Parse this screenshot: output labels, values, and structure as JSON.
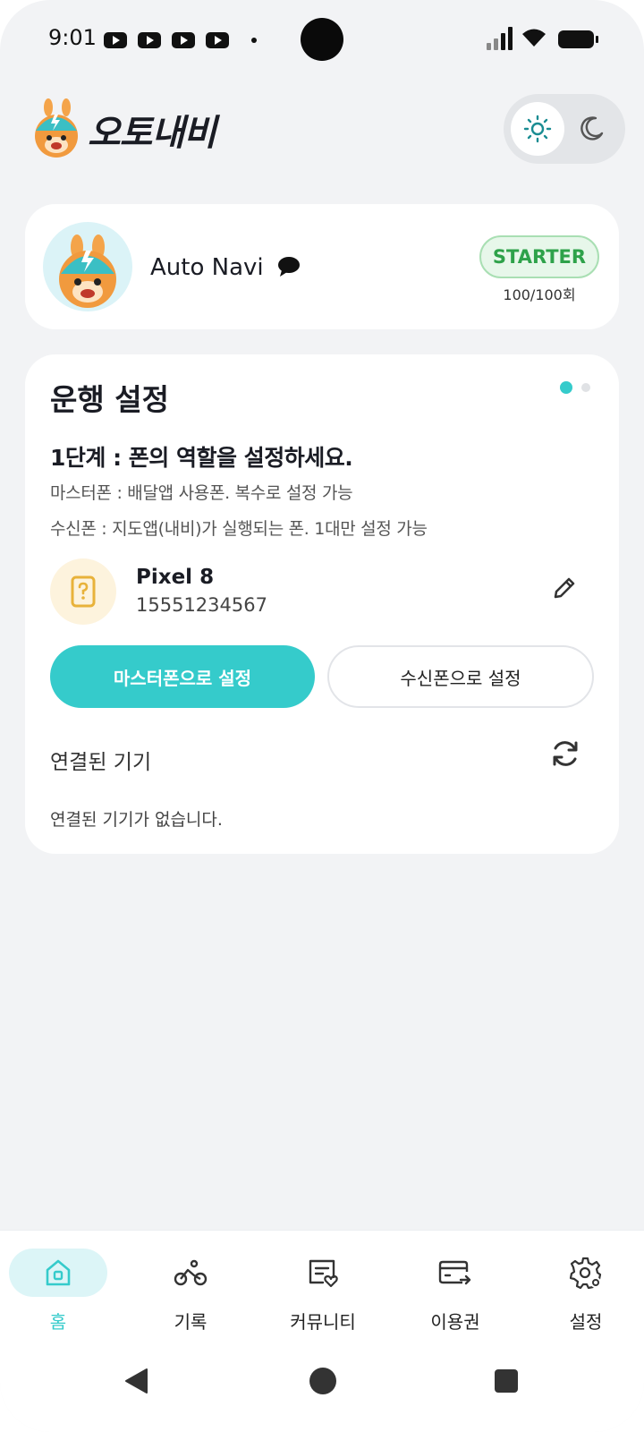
{
  "status_bar": {
    "time": "9:01"
  },
  "header": {
    "app_name": "오토내비",
    "theme_toggle": {
      "light_icon": "sun-icon",
      "dark_icon": "moon-icon",
      "selected": "light"
    }
  },
  "profile": {
    "name": "Auto Navi",
    "plan": "STARTER",
    "usage": "100/100회"
  },
  "settings": {
    "title": "운행 설정",
    "step_title": "1단계 : 폰의 역할을 설정하세요.",
    "desc_master": "마스터폰 : 배달앱 사용폰. 복수로 설정 가능",
    "desc_receiver": "수신폰 : 지도앱(내비)가 실행되는 폰. 1대만 설정 가능",
    "device": {
      "name": "Pixel 8",
      "number": "15551234567"
    },
    "btn_master": "마스터폰으로 설정",
    "btn_receiver": "수신폰으로 설정",
    "connected_title": "연결된 기기",
    "connected_empty": "연결된 기기가 없습니다."
  },
  "bottom_nav": {
    "items": [
      {
        "label": "홈",
        "icon": "home-icon",
        "active": true
      },
      {
        "label": "기록",
        "icon": "bike-icon",
        "active": false
      },
      {
        "label": "커뮤니티",
        "icon": "community-icon",
        "active": false
      },
      {
        "label": "이용권",
        "icon": "ticket-card-icon",
        "active": false
      },
      {
        "label": "설정",
        "icon": "gear-icon",
        "active": false
      }
    ]
  },
  "colors": {
    "accent": "#35cbcb",
    "badge_green": "#2ea24a",
    "background": "#f2f3f5"
  }
}
